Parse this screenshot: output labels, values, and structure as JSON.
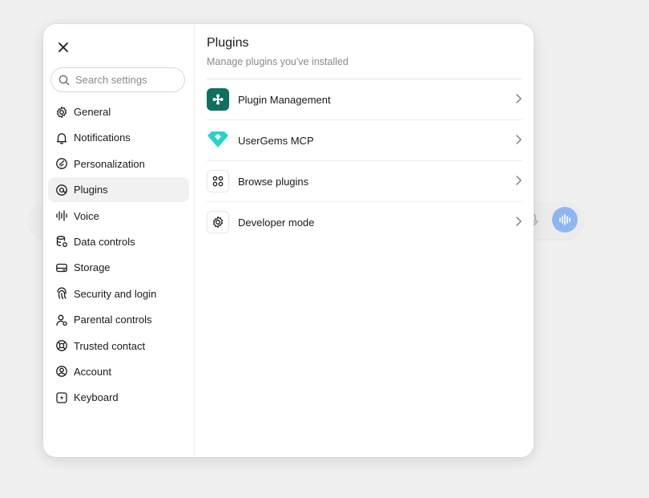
{
  "search": {
    "placeholder": "Search settings",
    "value": ""
  },
  "sidebar": {
    "items": [
      {
        "label": "General",
        "icon": "gear-icon"
      },
      {
        "label": "Notifications",
        "icon": "bell-icon"
      },
      {
        "label": "Personalization",
        "icon": "personalization-icon"
      },
      {
        "label": "Plugins",
        "icon": "plugin-icon",
        "active": true
      },
      {
        "label": "Voice",
        "icon": "waveform-icon"
      },
      {
        "label": "Data controls",
        "icon": "database-icon"
      },
      {
        "label": "Storage",
        "icon": "hard-drive-icon"
      },
      {
        "label": "Security and login",
        "icon": "fingerprint-icon"
      },
      {
        "label": "Parental controls",
        "icon": "parent-user-icon"
      },
      {
        "label": "Trusted contact",
        "icon": "lifebuoy-icon"
      },
      {
        "label": "Account",
        "icon": "user-circle-icon"
      },
      {
        "label": "Keyboard",
        "icon": "keyboard-icon"
      }
    ]
  },
  "main": {
    "title": "Plugins",
    "subtitle": "Manage plugins you've installed",
    "rows": [
      {
        "label": "Plugin Management",
        "icon": "plugin-management-icon"
      },
      {
        "label": "UserGems MCP",
        "icon": "gem-icon"
      },
      {
        "label": "Browse plugins",
        "icon": "grid-dots-icon"
      },
      {
        "label": "Developer mode",
        "icon": "gear-icon"
      }
    ]
  },
  "colors": {
    "accent_teal": "#0f7060",
    "gem": "#27d3c8",
    "voice_button": "#8fb6f3"
  }
}
